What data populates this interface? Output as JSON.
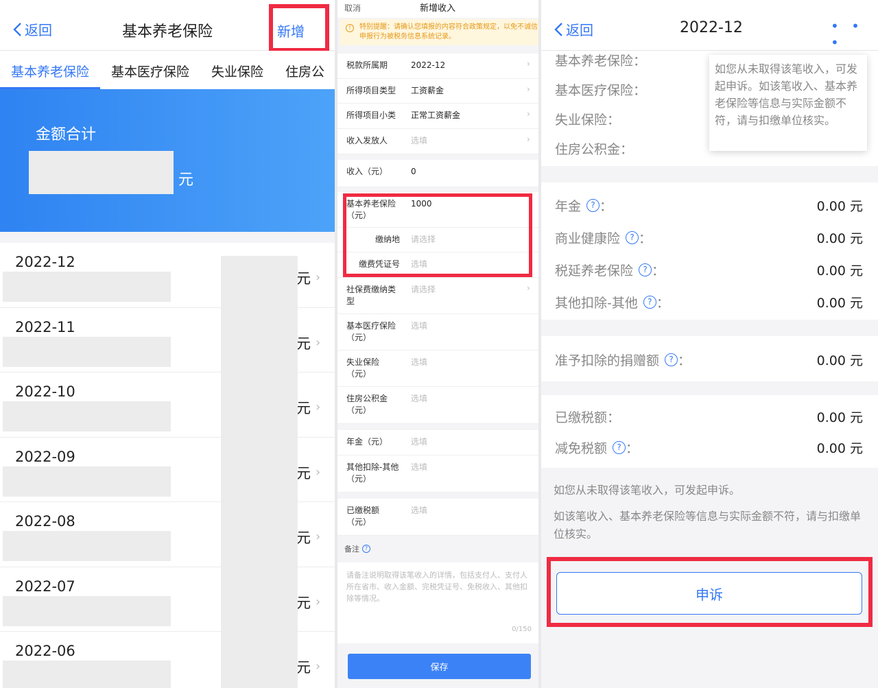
{
  "panel_list": {
    "back_label": "返回",
    "title": "基本养老保险",
    "add_label": "新增",
    "tabs": [
      "基本养老保险",
      "基本医疗保险",
      "失业保险",
      "住房公"
    ],
    "banner_label": "金额合计",
    "banner_unit": "元",
    "unit": "元",
    "months": [
      "2022-12",
      "2022-11",
      "2022-10",
      "2022-09",
      "2022-08",
      "2022-07",
      "2022-06"
    ]
  },
  "panel_form": {
    "cancel_label": "取消",
    "title": "新增收入",
    "notice": "特别提醒：请确认您填报的内容符合政策规定，以免不诚信申报行为被税务信息系统记录。",
    "rows": {
      "period": {
        "label": "税款所属期",
        "value": "2022-12"
      },
      "type": {
        "label": "所得项目类型",
        "value": "工资薪金"
      },
      "subtype": {
        "label": "所得项目小类",
        "value": "正常工资薪金"
      },
      "payer": {
        "label": "收入发放人",
        "value": "选填"
      },
      "income": {
        "label": "收入（元）",
        "value": "0"
      },
      "pension": {
        "label": "基本养老保险（元）",
        "value": "1000"
      },
      "place": {
        "label": "缴纳地",
        "value": "请选择"
      },
      "voucher": {
        "label": "缴费凭证号",
        "value": "选填"
      },
      "ss_type": {
        "label": "社保费缴纳类型",
        "value": "请选择"
      },
      "medical": {
        "label": "基本医疗保险（元）",
        "value": "选填"
      },
      "unemployment": {
        "label": "失业保险（元）",
        "value": "选填"
      },
      "housing": {
        "label": "住房公积金（元）",
        "value": "选填"
      },
      "annuity": {
        "label": "年金（元）",
        "value": "选填"
      },
      "other": {
        "label": "其他扣除-其他（元）",
        "value": "选填"
      },
      "taxpaid": {
        "label": "已缴税额（元）",
        "value": "选填"
      }
    },
    "remark_label": "备注",
    "remark_placeholder": "请备注说明取得该笔收入的详情，包括支付人、支付人所在省市、收入金额、完税凭证号、免税收入、其他扣除等情况。",
    "remark_count": "0/150",
    "save_label": "保存"
  },
  "panel_detail": {
    "back_label": "返回",
    "title": "2022-12",
    "more": "• • •",
    "top_rows": [
      "基本养老保险：",
      "基本医疗保险：",
      "失业保险：",
      "住房公积金："
    ],
    "tooltip": "如您从未取得该笔收入，可发起申诉。如该笔收入、基本养老保险等信息与实际金额不符，请与扣缴单位核实。",
    "rows": {
      "annuity": {
        "label": "年金",
        "value": "0.00 元"
      },
      "health": {
        "label": "商业健康险",
        "value": "0.00 元"
      },
      "deferred": {
        "label": "税延养老保险",
        "value": "0.00 元"
      },
      "other": {
        "label": "其他扣除-其他",
        "value": "0.00 元"
      },
      "donation": {
        "label": "准予扣除的捐赠额",
        "value": "0.00 元"
      },
      "taxpaid": {
        "label": "已缴税额：",
        "value": "0.00 元"
      },
      "reduced": {
        "label": "减免税额",
        "value": "0.00 元"
      }
    },
    "info_line1": "如您从未取得该笔收入，可发起申诉。",
    "info_line2": "如该笔收入、基本养老保险等信息与实际金额不符，请与扣缴单位核实。",
    "appeal_label": "申诉"
  },
  "colors": {
    "accent": "#3478f6",
    "highlight": "#ef2b43",
    "notice": "#e59a1a"
  }
}
